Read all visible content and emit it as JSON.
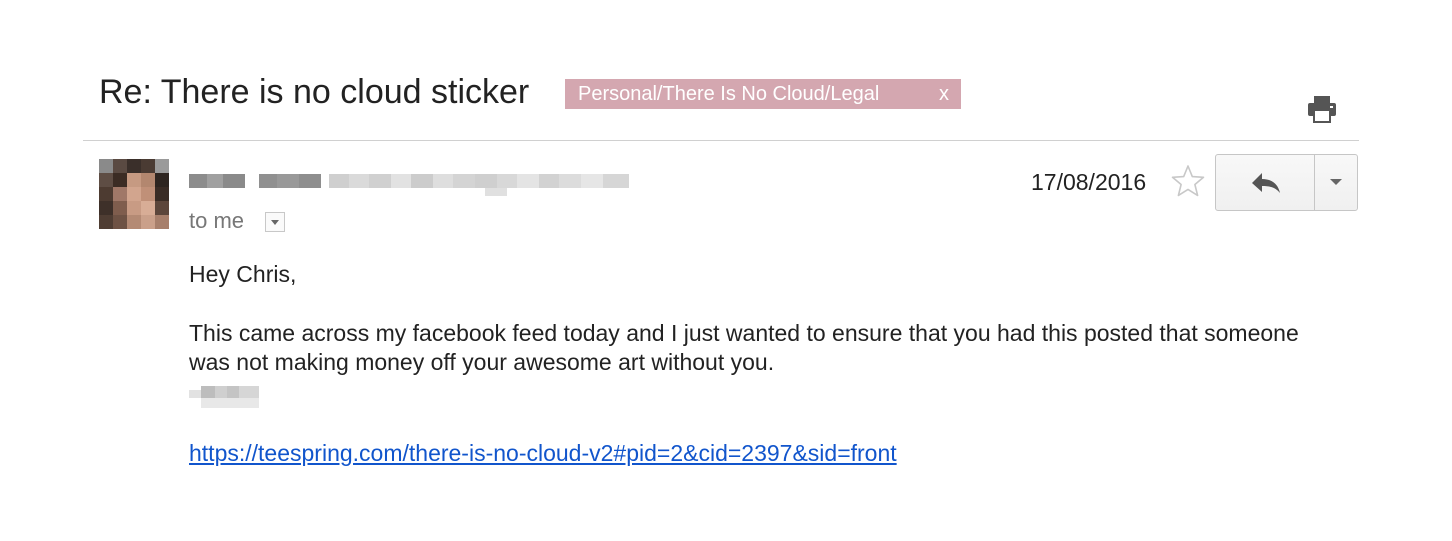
{
  "thread": {
    "subject": "Re: There is no cloud sticker",
    "label": {
      "text": "Personal/There Is No Cloud/Legal",
      "remove_glyph": "x",
      "color": "#d4a7b0"
    }
  },
  "toolbar": {
    "print_icon": "print-icon"
  },
  "message": {
    "sender_icon": "blurred-sender-name",
    "avatar_icon": "blurred-avatar",
    "to_text": "to me",
    "date": "17/08/2016",
    "starred": false,
    "reply_icon": "reply-icon",
    "more_icon": "chevron-down-icon",
    "body": {
      "greeting": "Hey Chris,",
      "paragraph": "This came across my facebook feed today and I just wanted to ensure that you had this posted that someone was not making money off your awesome art without you.",
      "signature_icon": "blurred-signature",
      "link": "https://teespring.com/there-is-no-cloud-v2#pid=2&cid=2397&sid=front"
    }
  },
  "colors": {
    "link": "#1155cc",
    "divider": "#d0d0d0",
    "muted_text": "#777777"
  }
}
